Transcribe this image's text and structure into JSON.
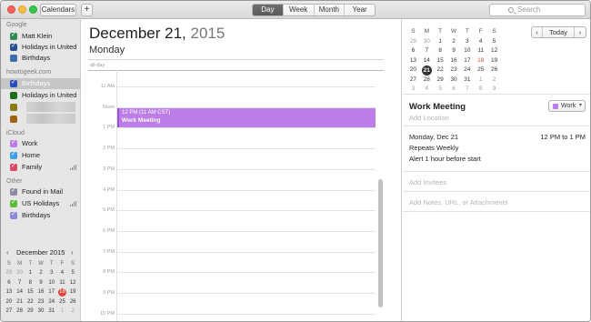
{
  "toolbar": {
    "calendars_label": "Calendars",
    "add_label": "+",
    "views": [
      "Day",
      "Week",
      "Month",
      "Year"
    ],
    "active_view": "Day",
    "search_placeholder": "Search"
  },
  "sidebar": {
    "groups": [
      {
        "title": "Google",
        "items": [
          {
            "label": "Matt Klein",
            "color": "#2e8b57",
            "checked": true
          },
          {
            "label": "Holidays in United States",
            "color": "#2c4f8e",
            "checked": true
          },
          {
            "label": "Birthdays",
            "color": "#3b6ea8",
            "checked": false
          }
        ]
      },
      {
        "title": "howtogeek.com",
        "items": [
          {
            "label": "Birthdays",
            "color": "#2c4fbf",
            "checked": true,
            "selected": true
          },
          {
            "label": "Holidays in United States",
            "color": "#1a6e1a",
            "checked": false
          },
          {
            "label": "",
            "color": "#8a7a12",
            "checked": false,
            "redacted": true
          },
          {
            "label": "",
            "color": "#a0620f",
            "checked": false,
            "redacted": true
          }
        ]
      },
      {
        "title": "iCloud",
        "items": [
          {
            "label": "Work",
            "color": "#bd7de8",
            "checked": true
          },
          {
            "label": "Home",
            "color": "#3aa0e8",
            "checked": true
          },
          {
            "label": "Family",
            "color": "#e0456a",
            "checked": true,
            "shared": true
          }
        ]
      },
      {
        "title": "Other",
        "items": [
          {
            "label": "Found in Mail",
            "color": "#8a8aa8",
            "checked": true
          },
          {
            "label": "US Holidays",
            "color": "#5bbd3a",
            "checked": true,
            "shared": true
          },
          {
            "label": "Birthdays",
            "color": "#8a8ad8",
            "checked": true
          }
        ]
      }
    ],
    "mini_calendar": {
      "month_label": "December 2015",
      "weekdays": [
        "S",
        "M",
        "T",
        "W",
        "T",
        "F",
        "S"
      ],
      "weeks": [
        [
          "29",
          "30",
          "1",
          "2",
          "3",
          "4",
          "5"
        ],
        [
          "6",
          "7",
          "8",
          "9",
          "10",
          "11",
          "12"
        ],
        [
          "13",
          "14",
          "15",
          "16",
          "17",
          "18",
          "19"
        ],
        [
          "20",
          "21",
          "22",
          "23",
          "24",
          "25",
          "26"
        ],
        [
          "27",
          "28",
          "29",
          "30",
          "31",
          "1",
          "2"
        ]
      ],
      "today": "18"
    }
  },
  "day_view": {
    "date_main": "December 21,",
    "date_year": "2015",
    "weekday": "Monday",
    "allday_label": "all-day",
    "hours": [
      "11 AM",
      "Noon",
      "1 PM",
      "2 PM",
      "3 PM",
      "4 PM",
      "5 PM",
      "6 PM",
      "7 PM",
      "8 PM",
      "9 PM",
      "10 PM"
    ],
    "event": {
      "time": "12 PM (11 AM CST)",
      "title": "Work Meeting",
      "color": "#bd7de8"
    }
  },
  "right_panel": {
    "mini_calendar": {
      "weekdays": [
        "S",
        "M",
        "T",
        "W",
        "T",
        "F",
        "S"
      ],
      "weeks": [
        [
          "29",
          "30",
          "1",
          "2",
          "3",
          "4",
          "5"
        ],
        [
          "6",
          "7",
          "8",
          "9",
          "10",
          "11",
          "12"
        ],
        [
          "13",
          "14",
          "15",
          "16",
          "17",
          "18",
          "19"
        ],
        [
          "20",
          "21",
          "22",
          "23",
          "24",
          "25",
          "26"
        ],
        [
          "27",
          "28",
          "29",
          "30",
          "31",
          "1",
          "2"
        ],
        [
          "3",
          "4",
          "5",
          "6",
          "7",
          "8",
          "9"
        ]
      ],
      "selected": "21",
      "highlight": "18"
    },
    "nav": {
      "prev": "‹",
      "today": "Today",
      "next": "›"
    },
    "event": {
      "title": "Work Meeting",
      "calendar": "Work",
      "location_placeholder": "Add Location",
      "date": "Monday, Dec 21",
      "time_range": "12 PM to 1 PM",
      "repeat": "Repeats Weekly",
      "alert": "Alert 1 hour before start",
      "invitees_placeholder": "Add Invitees",
      "notes_placeholder": "Add Notes, URL, or Attachments"
    }
  }
}
